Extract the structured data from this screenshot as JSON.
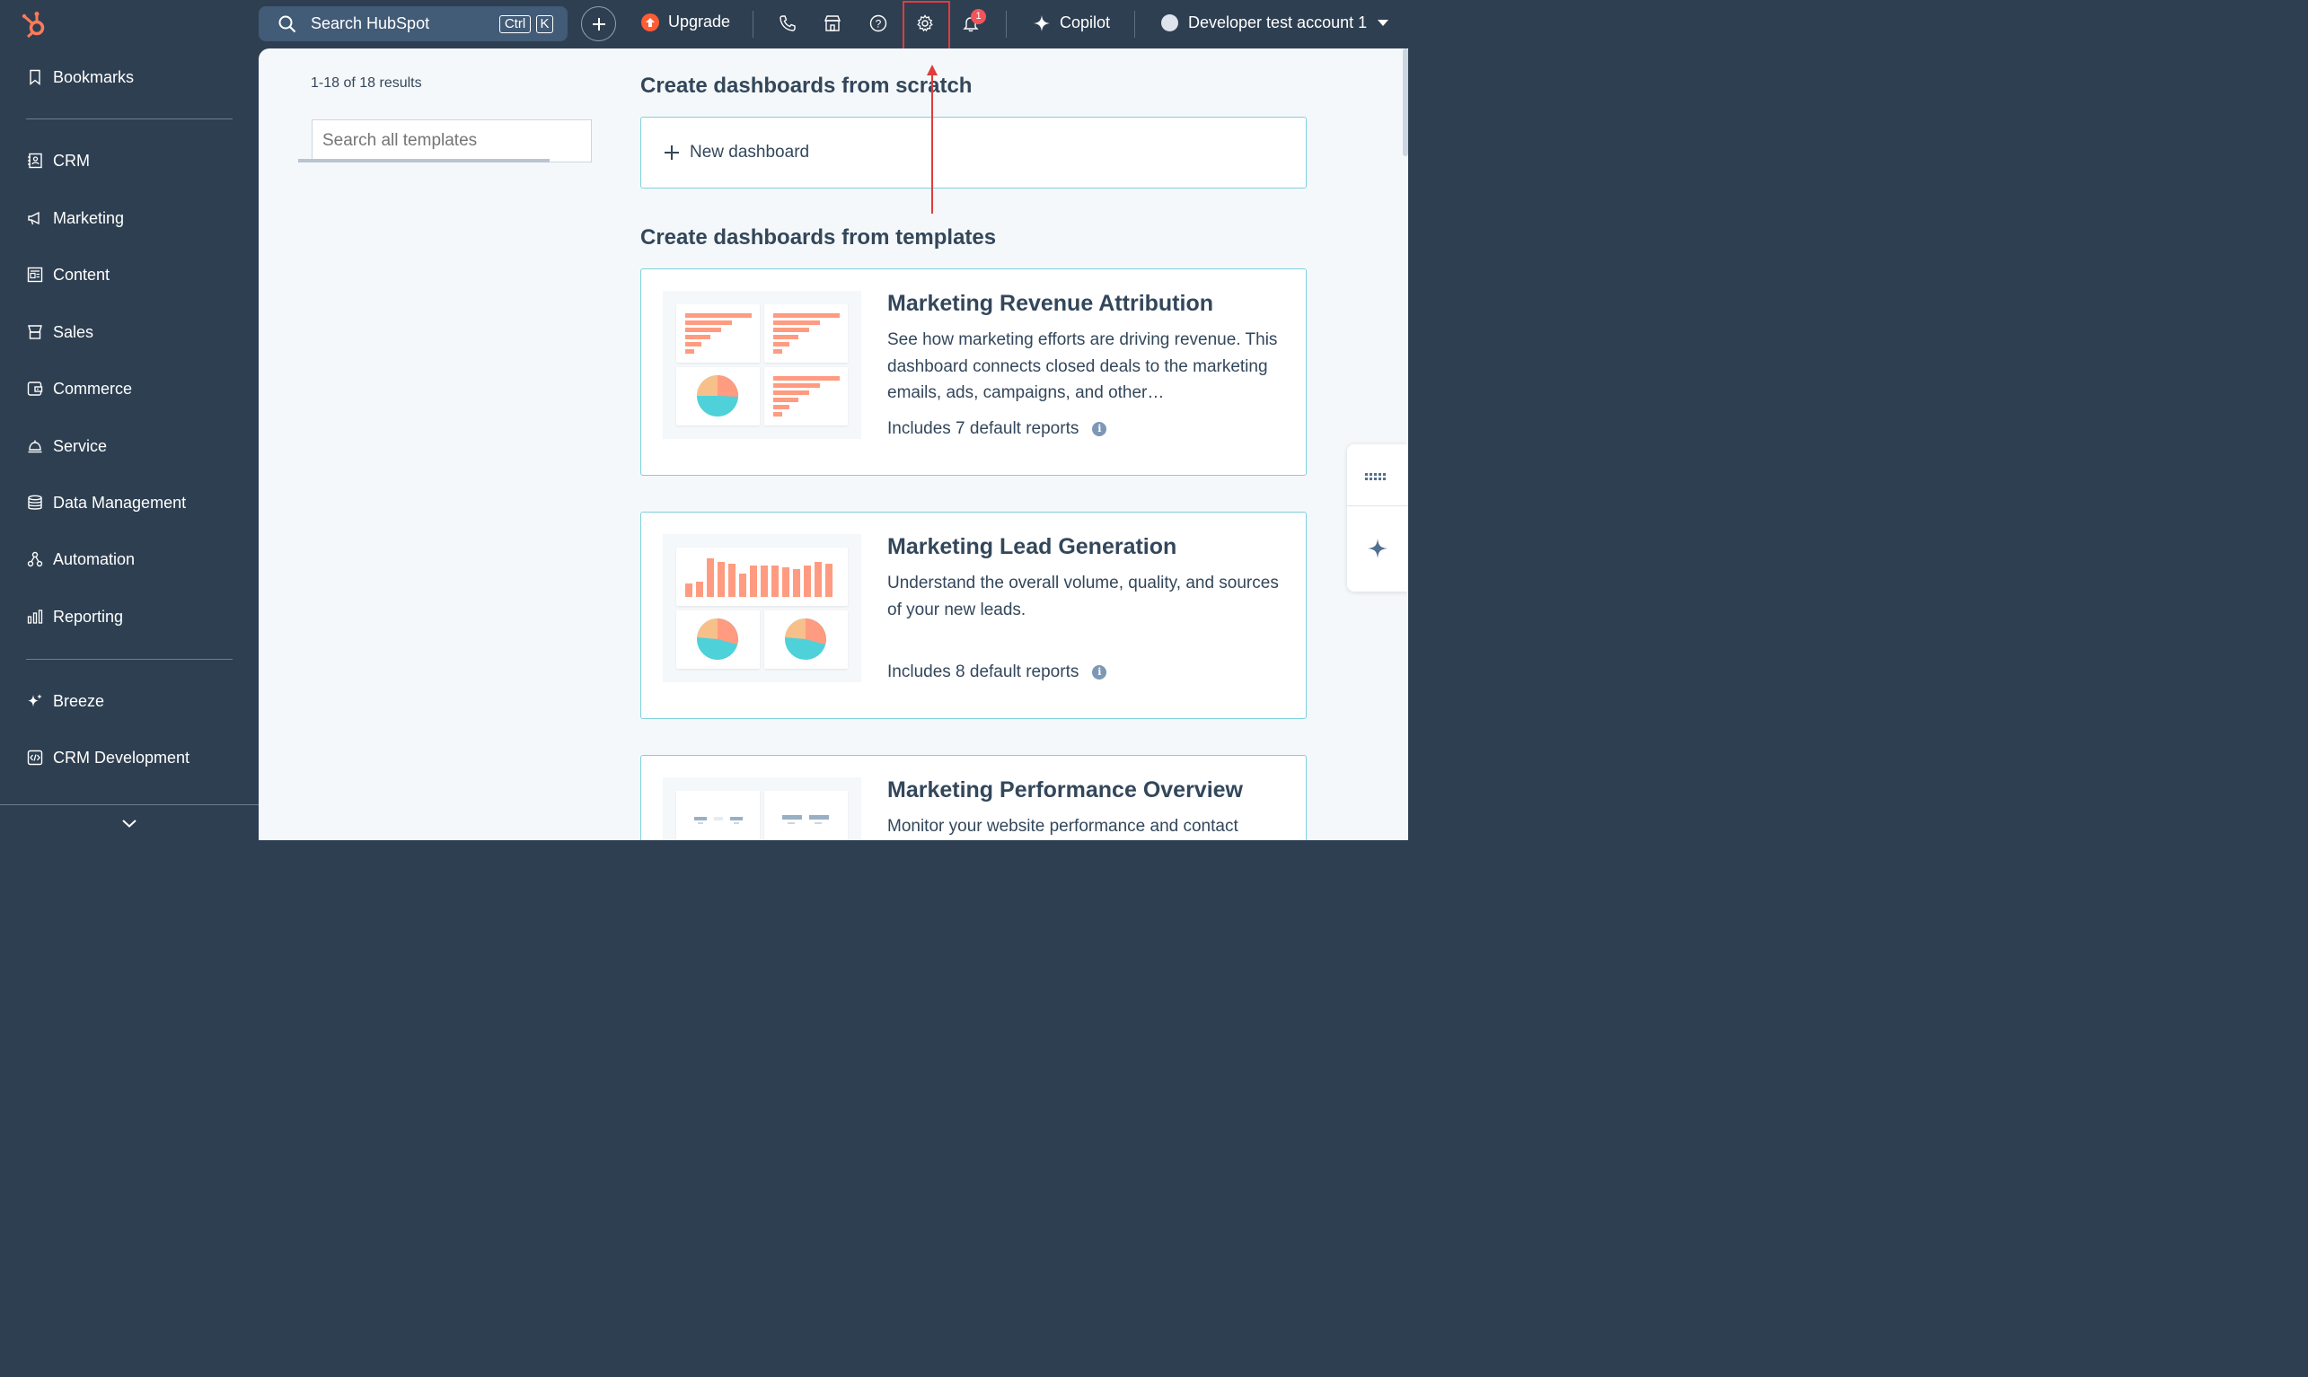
{
  "topbar": {
    "search_label": "Search HubSpot",
    "shortcut_ctrl": "Ctrl",
    "shortcut_key": "K",
    "upgrade_label": "Upgrade",
    "notification_count": "1",
    "copilot_label": "Copilot",
    "account_label": "Developer test account 1"
  },
  "sidebar": {
    "items": [
      {
        "label": "Bookmarks",
        "icon": "bookmark-icon"
      },
      {
        "label": "CRM",
        "icon": "contacts-icon"
      },
      {
        "label": "Marketing",
        "icon": "megaphone-icon"
      },
      {
        "label": "Content",
        "icon": "content-icon"
      },
      {
        "label": "Sales",
        "icon": "sales-icon"
      },
      {
        "label": "Commerce",
        "icon": "commerce-icon"
      },
      {
        "label": "Service",
        "icon": "service-bell-icon"
      },
      {
        "label": "Data Management",
        "icon": "database-icon"
      },
      {
        "label": "Automation",
        "icon": "automation-icon"
      },
      {
        "label": "Reporting",
        "icon": "bar-chart-icon"
      },
      {
        "label": "Breeze",
        "icon": "sparkle-icon"
      },
      {
        "label": "CRM Development",
        "icon": "code-icon"
      }
    ]
  },
  "main": {
    "results_text": "1-18 of 18 results",
    "template_search_placeholder": "Search all templates",
    "scratch_heading": "Create dashboards from scratch",
    "new_dashboard_label": "New dashboard",
    "templates_heading": "Create dashboards from templates",
    "cards": [
      {
        "title": "Marketing Revenue Attribution",
        "description": "See how marketing efforts are driving revenue. This dashboard connects closed deals to the marketing emails, ads, campaigns, and other…",
        "count": "Includes 7 default reports"
      },
      {
        "title": "Marketing Lead Generation",
        "description": "Understand the overall volume, quality, and sources of your new leads.",
        "count": "Includes 8 default reports"
      },
      {
        "title": "Marketing Performance Overview",
        "description": "Monitor your website performance and contact",
        "count": ""
      }
    ]
  },
  "colors": {
    "nav_bg": "#2e3f51",
    "accent_teal": "#7fd1de",
    "highlight_red": "#e03c3c",
    "chart_salmon": "#ff9b80",
    "chart_teal": "#4fd1d9",
    "chart_orange": "#f7c08a"
  }
}
